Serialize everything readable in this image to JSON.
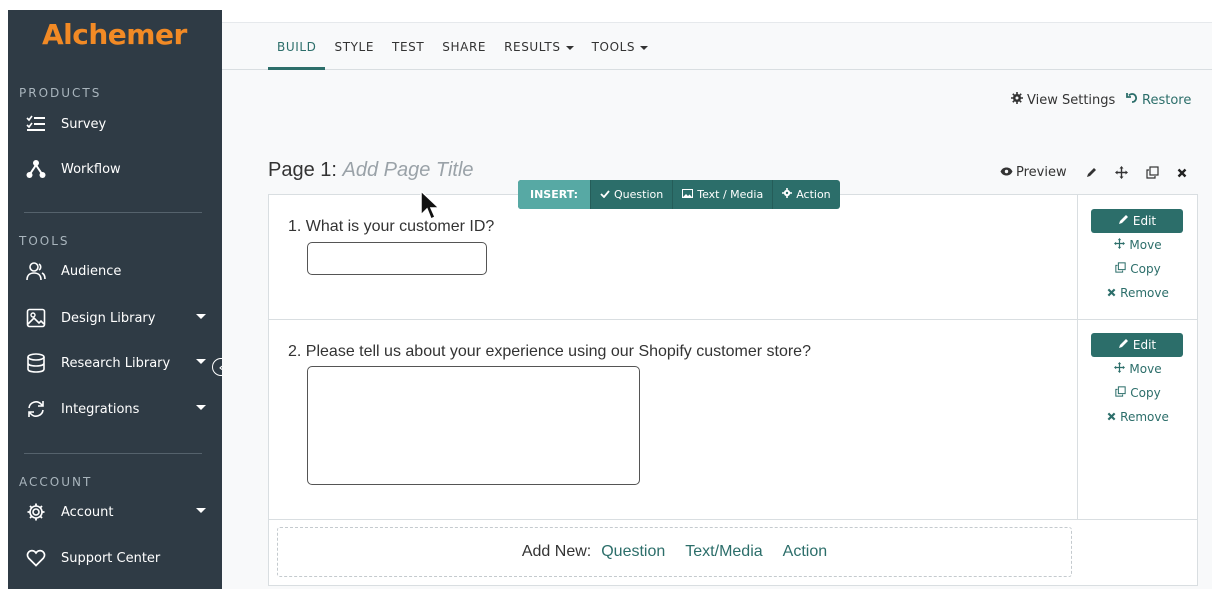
{
  "brand": {
    "name": "Alchemer",
    "color": "#f28a25"
  },
  "colors": {
    "sidebar_bg": "#2f3b45",
    "accent": "#2c6e6a",
    "insert_label": "#57a9a4"
  },
  "sidebar": {
    "products_title": "PRODUCTS",
    "products": [
      {
        "label": "Survey",
        "icon": "survey-list-icon"
      },
      {
        "label": "Workflow",
        "icon": "workflow-icon"
      }
    ],
    "tools_title": "TOOLS",
    "tools": [
      {
        "label": "Audience",
        "icon": "audience-icon"
      },
      {
        "label": "Design Library",
        "icon": "image-icon",
        "dropdown": true
      },
      {
        "label": "Research Library",
        "icon": "database-icon",
        "dropdown": true
      },
      {
        "label": "Integrations",
        "icon": "sync-icon",
        "dropdown": true
      }
    ],
    "account_title": "ACCOUNT",
    "account": [
      {
        "label": "Account",
        "icon": "gear-icon",
        "dropdown": true
      },
      {
        "label": "Support Center",
        "icon": "heart-icon"
      }
    ]
  },
  "topnav": {
    "tabs": [
      {
        "label": "BUILD",
        "active": true
      },
      {
        "label": "STYLE"
      },
      {
        "label": "TEST"
      },
      {
        "label": "SHARE"
      },
      {
        "label": "RESULTS",
        "dropdown": true
      },
      {
        "label": "TOOLS",
        "dropdown": true
      }
    ]
  },
  "header": {
    "view_settings": "View Settings",
    "restore": "Restore"
  },
  "page": {
    "title_prefix": "Page 1:",
    "title_placeholder": "Add Page Title",
    "preview": "Preview"
  },
  "insert_bar": {
    "label": "INSERT:",
    "question": "Question",
    "text_media": "Text / Media",
    "action": "Action"
  },
  "questions": [
    {
      "text": "1. What is your customer ID?",
      "type": "textbox"
    },
    {
      "text": "2. Please tell us about your experience using our Shopify customer store?",
      "type": "essay"
    }
  ],
  "question_actions": {
    "edit": "Edit",
    "move": "Move",
    "copy": "Copy",
    "remove": "Remove"
  },
  "add_new": {
    "label": "Add New:",
    "question": "Question",
    "text_media": "Text/Media",
    "action": "Action"
  }
}
